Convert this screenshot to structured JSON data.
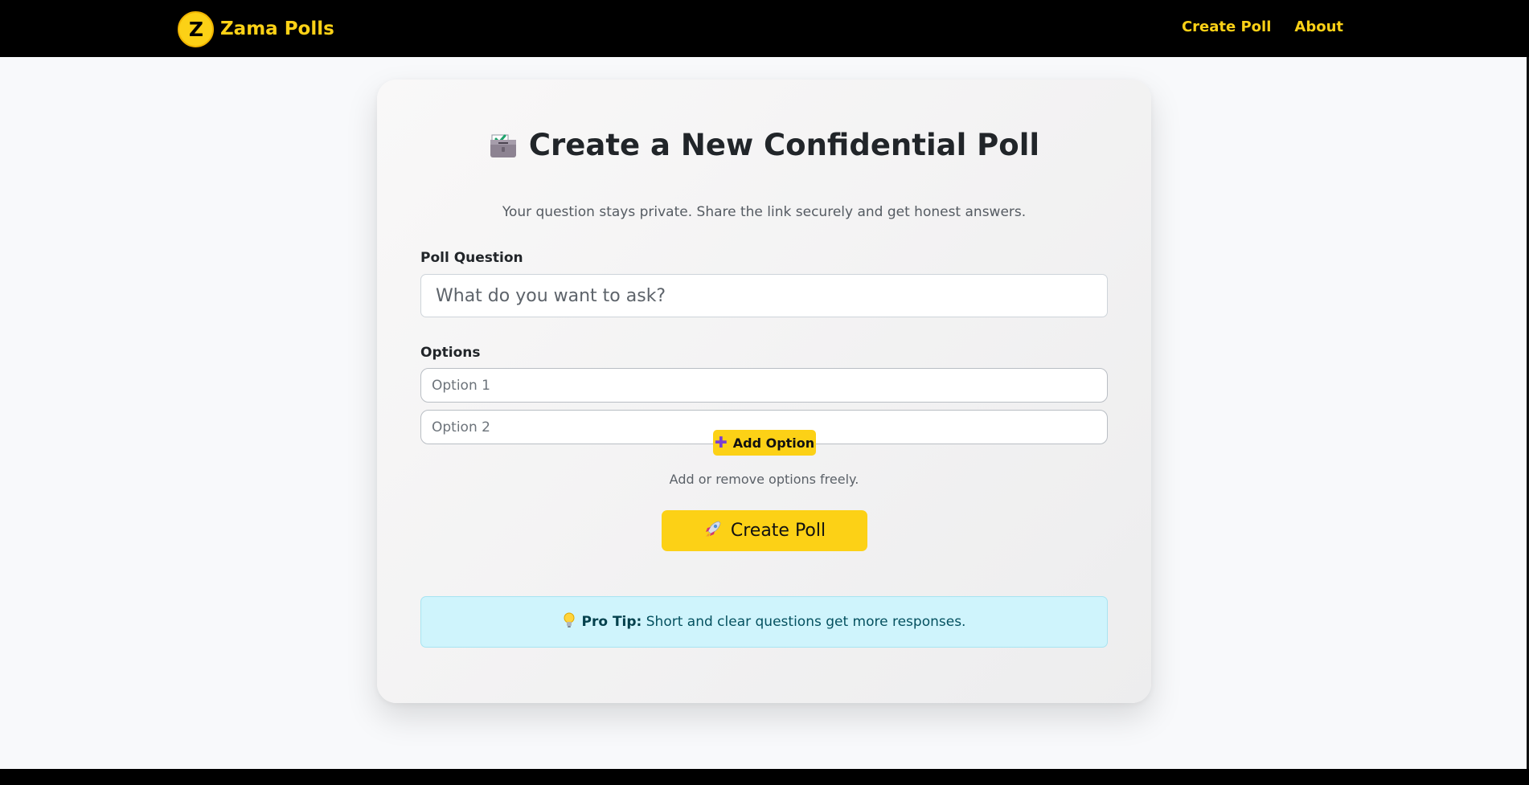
{
  "navbar": {
    "brand_letter": "Z",
    "brand_name": "Zama Polls",
    "links": [
      "Create Poll",
      "About"
    ]
  },
  "form": {
    "title": "Create a New Confidential Poll",
    "subtitle": "Your question stays private. Share the link securely and get honest answers.",
    "question_label": "Poll Question",
    "question_placeholder": "What do you want to ask?",
    "question_value": "",
    "options_label": "Options",
    "options": [
      {
        "placeholder": "Option 1",
        "value": ""
      },
      {
        "placeholder": "Option 2",
        "value": ""
      }
    ],
    "add_option_label": "Add Option",
    "options_hint": "Add or remove options freely.",
    "submit_label": "Create Poll"
  },
  "tip": {
    "icon": "lightbulb-icon",
    "heading": "Pro Tip:",
    "text": "Short and clear questions get more responses."
  },
  "colors": {
    "accent": "#fcd116",
    "navbar_bg": "#000000",
    "page_bg": "#f8f9fb",
    "tip_bg": "#cff4fc"
  }
}
